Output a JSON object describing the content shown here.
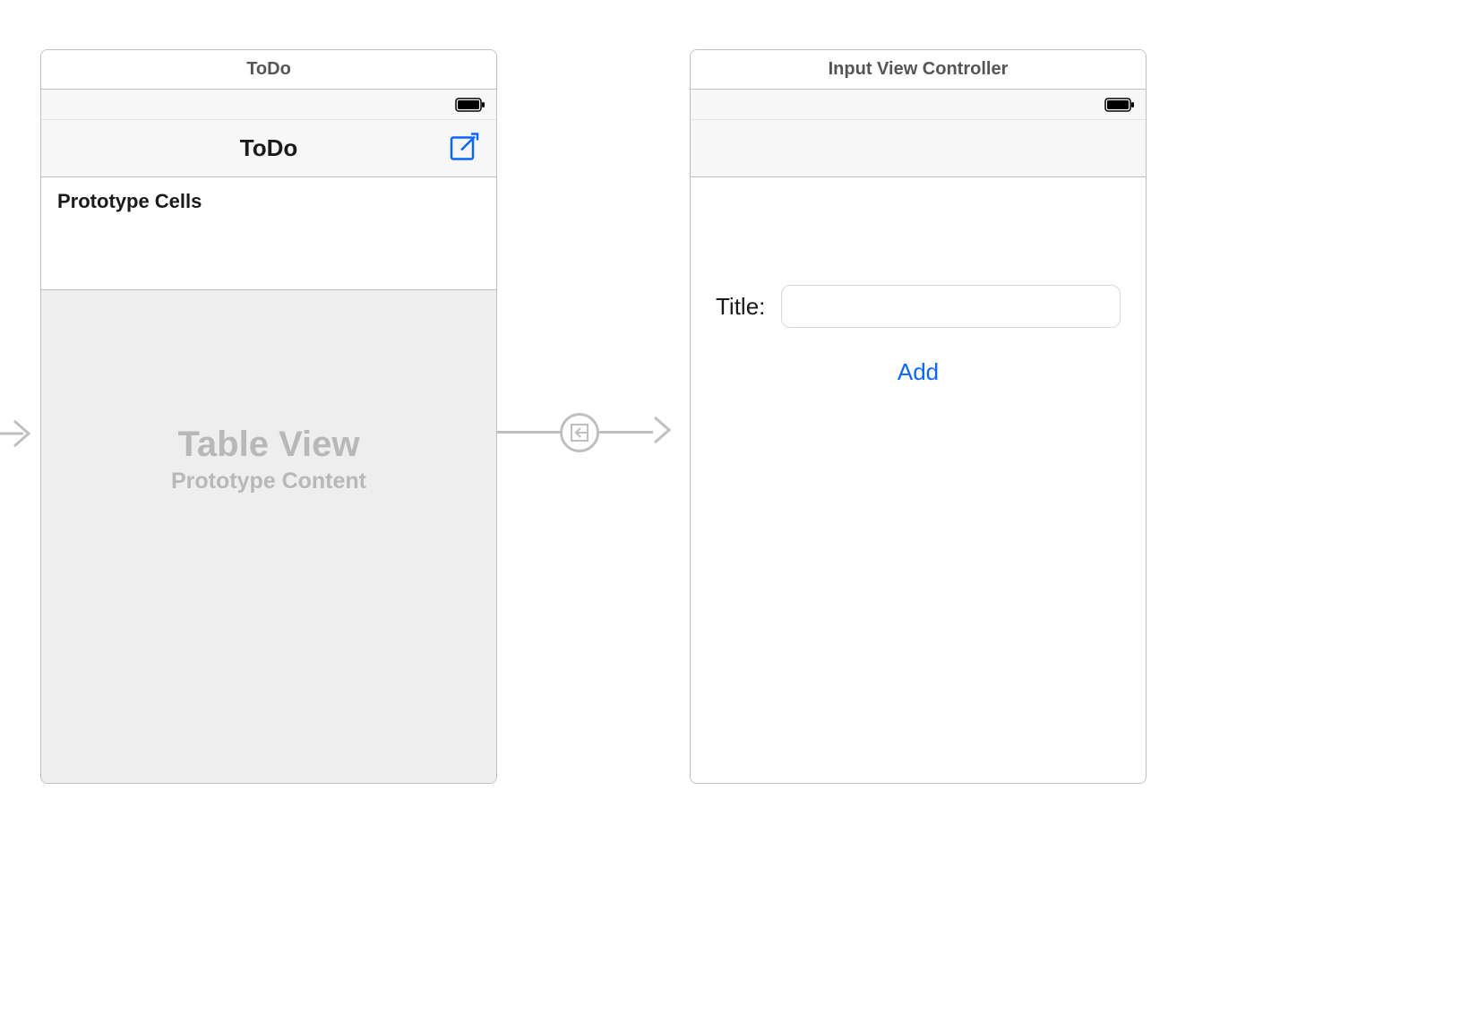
{
  "scenes": {
    "todo": {
      "scene_title": "ToDo",
      "navbar_title": "ToDo",
      "prototype_label": "Prototype Cells",
      "tableview_title": "Table View",
      "tableview_subtitle": "Prototype Content"
    },
    "input": {
      "scene_title": "Input View Controller",
      "form": {
        "title_label": "Title:",
        "title_value": "",
        "add_label": "Add"
      }
    }
  },
  "colors": {
    "tint": "#0a66ff",
    "border": "#bfbfbf",
    "placeholder_text": "#b8b8b8"
  }
}
